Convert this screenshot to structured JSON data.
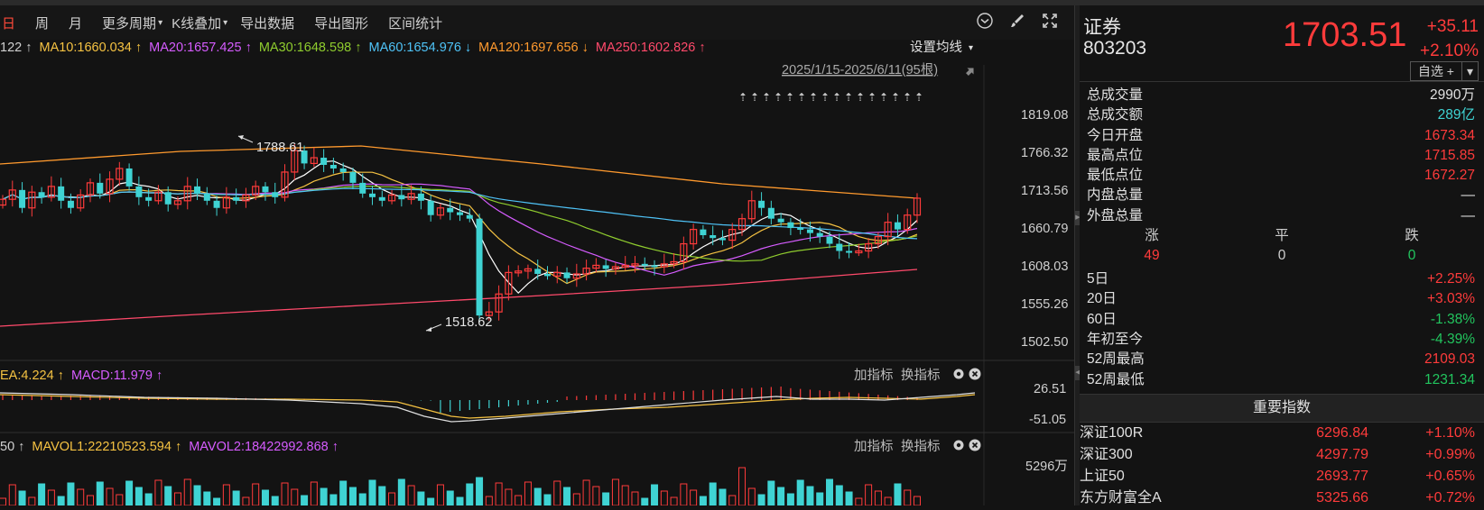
{
  "toolbar": {
    "items": [
      "日",
      "周",
      "月",
      "更多周期",
      "K线叠加",
      "导出数据",
      "导出图形",
      "区间统计"
    ]
  },
  "ma_legend": [
    {
      "text": "122 ↑",
      "color": "#d0d0d0"
    },
    {
      "text": "MA10:1660.034 ↑",
      "color": "#f5c242"
    },
    {
      "text": "MA20:1657.425 ↑",
      "color": "#d65cff"
    },
    {
      "text": "MA30:1648.598 ↑",
      "color": "#8fcc2e"
    },
    {
      "text": "MA60:1654.976 ↓",
      "color": "#4fc3f7"
    },
    {
      "text": "MA120:1697.656 ↓",
      "color": "#ff9a2e"
    },
    {
      "text": "MA250:1602.826 ↑",
      "color": "#ff4a6b"
    }
  ],
  "settings_ma": "设置均线",
  "date_range": "2025/1/15-2025/6/11(95根)",
  "y_labels": [
    "1819.08",
    "1766.32",
    "1713.56",
    "1660.79",
    "1608.03",
    "1555.26",
    "1502.50"
  ],
  "annotations": {
    "high": "1788.61",
    "low": "1518.62"
  },
  "macd_legend": [
    {
      "text": "EA:4.224 ↑",
      "color": "#f5c242"
    },
    {
      "text": "MACD:11.979 ↑",
      "color": "#d65cff"
    }
  ],
  "macd_y": [
    "26.51",
    "-51.05"
  ],
  "vol_legend": [
    {
      "text": "50 ↑",
      "color": "#d0d0d0"
    },
    {
      "text": "MAVOL1:22210523.594 ↑",
      "color": "#f5c242"
    },
    {
      "text": "MAVOL2:18422992.868 ↑",
      "color": "#d65cff"
    }
  ],
  "vol_y": "5296万",
  "indicator_tools": {
    "add": "加指标",
    "switch": "换指标"
  },
  "quote": {
    "name": "证券",
    "code": "803203",
    "price": "1703.51",
    "change": "+35.11",
    "change_pct": "+2.10%",
    "watch": "自选 +"
  },
  "stats": [
    {
      "k": "总成交量",
      "v": "2990万",
      "c": "white"
    },
    {
      "k": "总成交额",
      "v": "289亿",
      "c": "cyan"
    },
    {
      "k": "今日开盘",
      "v": "1673.34",
      "c": "red"
    },
    {
      "k": "最高点位",
      "v": "1715.85",
      "c": "red"
    },
    {
      "k": "最低点位",
      "v": "1672.27",
      "c": "red"
    },
    {
      "k": "内盘总量",
      "v": "—",
      "c": "white"
    },
    {
      "k": "外盘总量",
      "v": "—",
      "c": "white"
    }
  ],
  "udf": {
    "labels": [
      "涨",
      "平",
      "跌"
    ],
    "values": [
      "49",
      "0",
      "0"
    ]
  },
  "perf": [
    {
      "k": "5日",
      "v": "+2.25%",
      "c": "red"
    },
    {
      "k": "20日",
      "v": "+3.03%",
      "c": "red"
    },
    {
      "k": "60日",
      "v": "-1.38%",
      "c": "green"
    },
    {
      "k": "年初至今",
      "v": "-4.39%",
      "c": "green"
    },
    {
      "k": "52周最高",
      "v": "2109.03",
      "c": "red"
    },
    {
      "k": "52周最低",
      "v": "1231.34",
      "c": "green"
    }
  ],
  "index_header": "重要指数",
  "indices": [
    {
      "n": "深证100R",
      "v": "6296.84",
      "p": "+1.10%"
    },
    {
      "n": "深证300",
      "v": "4297.79",
      "p": "+0.99%"
    },
    {
      "n": "上证50",
      "v": "2693.77",
      "p": "+0.65%"
    },
    {
      "n": "东方财富全A",
      "v": "5325.66",
      "p": "+0.72%"
    }
  ],
  "chart_data": {
    "type": "candlestick",
    "ylim": [
      1502.5,
      1819.08
    ],
    "count": 95,
    "closes": [
      1702,
      1715,
      1690,
      1712,
      1705,
      1720,
      1700,
      1690,
      1708,
      1725,
      1710,
      1730,
      1745,
      1720,
      1705,
      1700,
      1712,
      1695,
      1700,
      1720,
      1710,
      1700,
      1690,
      1705,
      1700,
      1708,
      1720,
      1712,
      1705,
      1740,
      1770,
      1752,
      1760,
      1750,
      1745,
      1740,
      1725,
      1710,
      1705,
      1700,
      1708,
      1702,
      1710,
      1700,
      1680,
      1690,
      1684,
      1680,
      1675,
      1540,
      1545,
      1570,
      1600,
      1602,
      1605,
      1598,
      1595,
      1600,
      1592,
      1598,
      1606,
      1610,
      1605,
      1608,
      1610,
      1612,
      1610,
      1608,
      1612,
      1615,
      1640,
      1660,
      1652,
      1648,
      1645,
      1660,
      1675,
      1700,
      1690,
      1675,
      1670,
      1662,
      1660,
      1655,
      1650,
      1640,
      1630,
      1628,
      1630,
      1640,
      1650,
      1670,
      1660,
      1680,
      1703.51
    ]
  }
}
